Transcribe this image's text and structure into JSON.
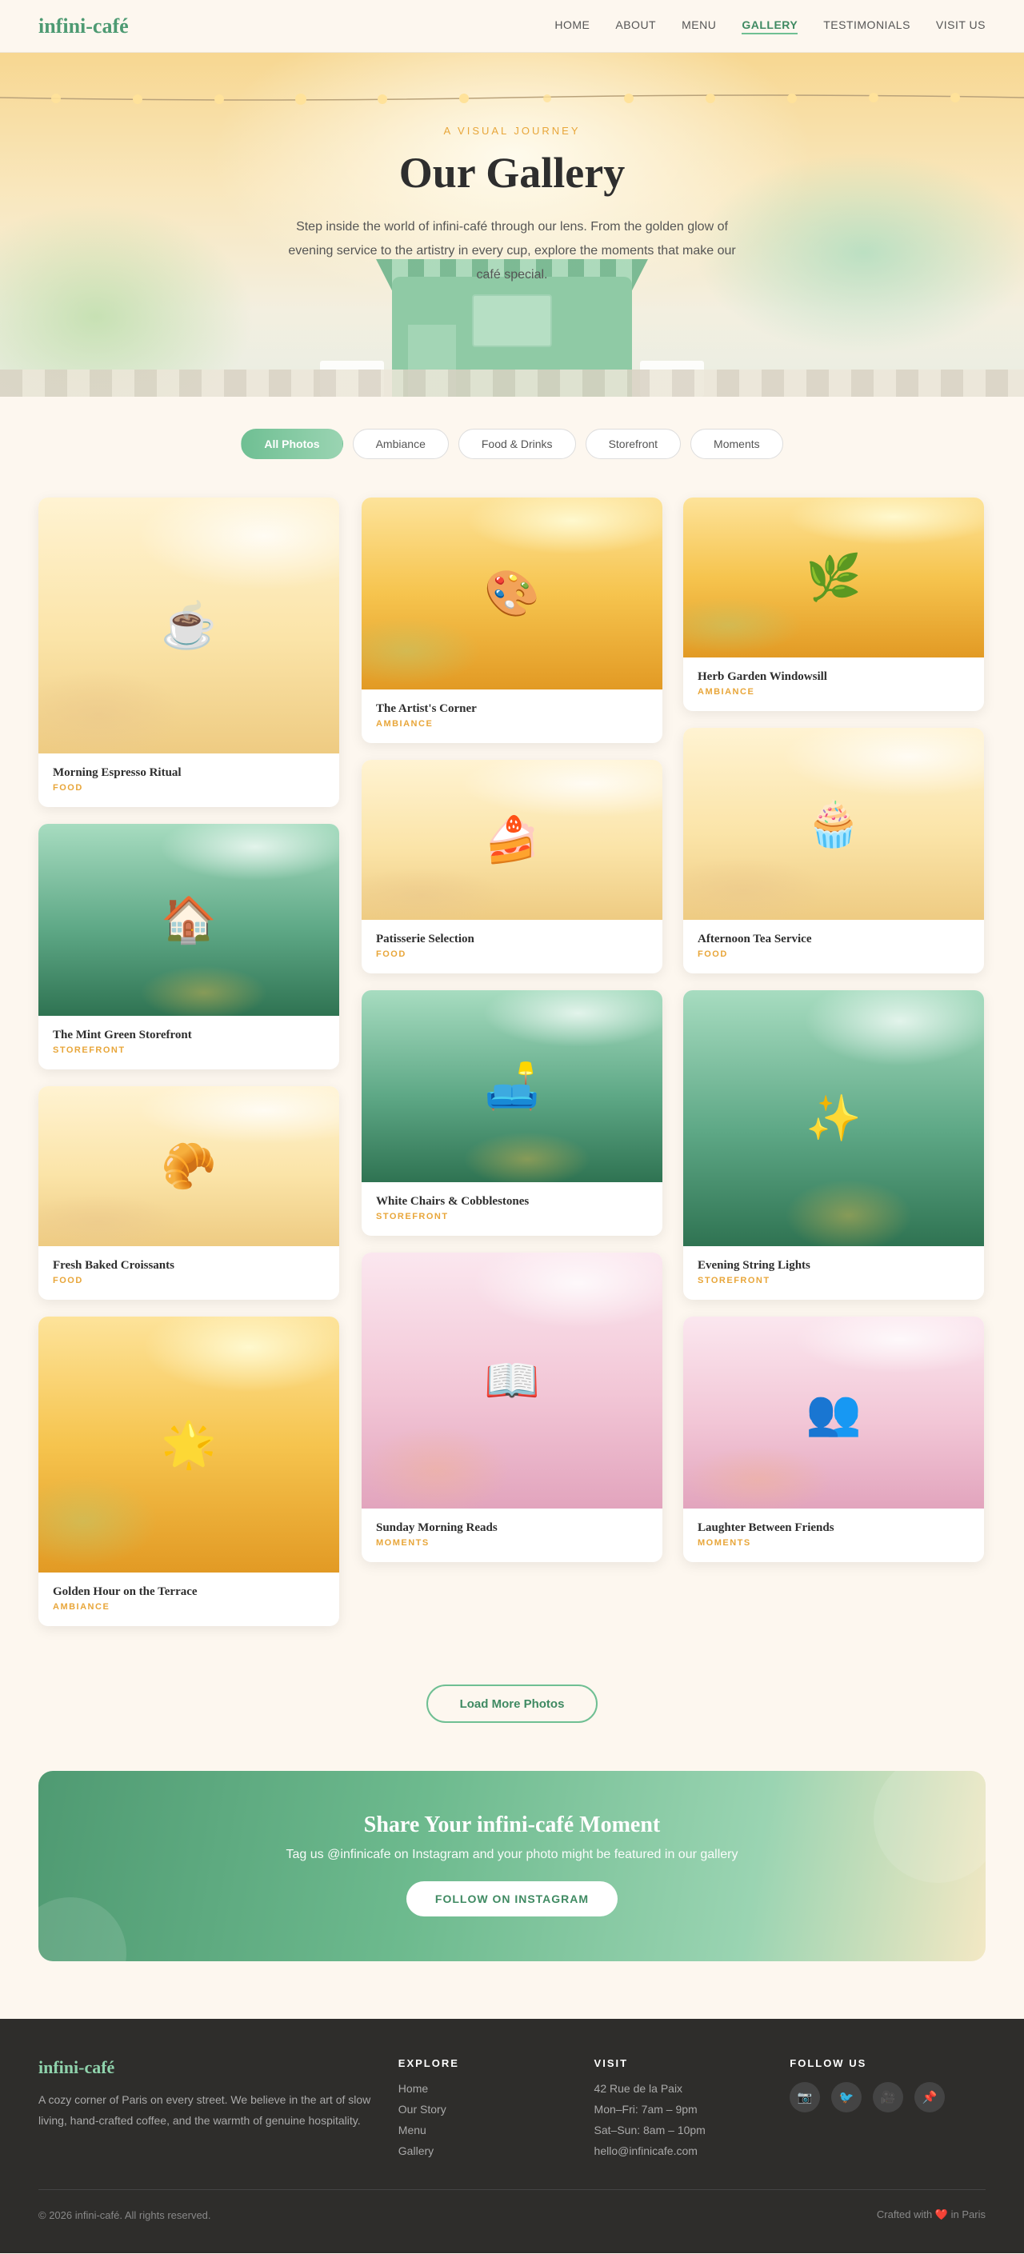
{
  "nav": {
    "logo": "infini-café",
    "links": [
      "HOME",
      "ABOUT",
      "MENU",
      "GALLERY",
      "TESTIMONIALS",
      "VISIT US"
    ],
    "active": "GALLERY"
  },
  "hero": {
    "eyebrow": "A VISUAL JOURNEY",
    "title": "Our Gallery",
    "subtitle": "Step inside the world of infini-café through our lens. From the golden glow of evening service to the artistry in every cup, explore the moments that make our café special."
  },
  "filters": [
    "All Photos",
    "Ambiance",
    "Food & Drinks",
    "Storefront",
    "Moments"
  ],
  "gallery": {
    "cards": [
      {
        "title": "Morning Espresso Ritual",
        "category": "FOOD",
        "icon": "☕",
        "icon_name": "coffee-icon",
        "theme": "cream"
      },
      {
        "title": "The Mint Green Storefront",
        "category": "STOREFRONT",
        "icon": "🏠",
        "icon_name": "house-icon",
        "theme": "mint"
      },
      {
        "title": "Fresh Baked Croissants",
        "category": "FOOD",
        "icon": "🥐",
        "icon_name": "croissant-icon",
        "theme": "cream"
      },
      {
        "title": "Golden Hour on the Terrace",
        "category": "AMBIANCE",
        "icon": "🌟",
        "icon_name": "star-icon",
        "theme": "gold"
      },
      {
        "title": "The Artist's Corner",
        "category": "AMBIANCE",
        "icon": "🎨",
        "icon_name": "palette-icon",
        "theme": "gold"
      },
      {
        "title": "Patisserie Selection",
        "category": "FOOD",
        "icon": "🍰",
        "icon_name": "cake-icon",
        "theme": "cream"
      },
      {
        "title": "White Chairs & Cobblestones",
        "category": "STOREFRONT",
        "icon": "🛋️",
        "icon_name": "couch-icon",
        "theme": "mint"
      },
      {
        "title": "Sunday Morning Reads",
        "category": "MOMENTS",
        "icon": "📖",
        "icon_name": "book-icon",
        "theme": "pink"
      },
      {
        "title": "Herb Garden Windowsill",
        "category": "AMBIANCE",
        "icon": "🌿",
        "icon_name": "herb-icon",
        "theme": "gold"
      },
      {
        "title": "Afternoon Tea Service",
        "category": "FOOD",
        "icon": "🧁",
        "icon_name": "cupcake-icon",
        "theme": "cream"
      },
      {
        "title": "Evening String Lights",
        "category": "STOREFRONT",
        "icon": "✨",
        "icon_name": "sparkles-icon",
        "theme": "mint"
      },
      {
        "title": "Laughter Between Friends",
        "category": "MOMENTS",
        "icon": "👥",
        "icon_name": "people-icon",
        "theme": "pink"
      }
    ]
  },
  "load_more": "Load More Photos",
  "share": {
    "title": "Share Your infini-café Moment",
    "subtitle": "Tag us @infinicafe on Instagram and your photo might be featured in our gallery",
    "button": "FOLLOW ON INSTAGRAM"
  },
  "footer": {
    "logo": "infini-café",
    "description": "A cozy corner of Paris on every street. We believe in the art of slow living, hand-crafted coffee, and the warmth of genuine hospitality.",
    "explore": {
      "heading": "EXPLORE",
      "items": [
        "Home",
        "Our Story",
        "Menu",
        "Gallery"
      ]
    },
    "visit": {
      "heading": "VISIT",
      "items": [
        "42 Rue de la Paix",
        "Mon–Fri: 7am – 9pm",
        "Sat–Sun: 8am – 10pm",
        "hello@infinicafe.com"
      ]
    },
    "follow": {
      "heading": "FOLLOW US",
      "icons": [
        "📷",
        "🐦",
        "🎥",
        "📌"
      ]
    },
    "copyright": "© 2026 infini-café. All rights reserved.",
    "crafted": "Crafted with ❤️ in Paris"
  },
  "colors": {
    "brand": "#4d9a72",
    "accent": "#e8a63a",
    "footer_bg": "#2e2d2b"
  }
}
